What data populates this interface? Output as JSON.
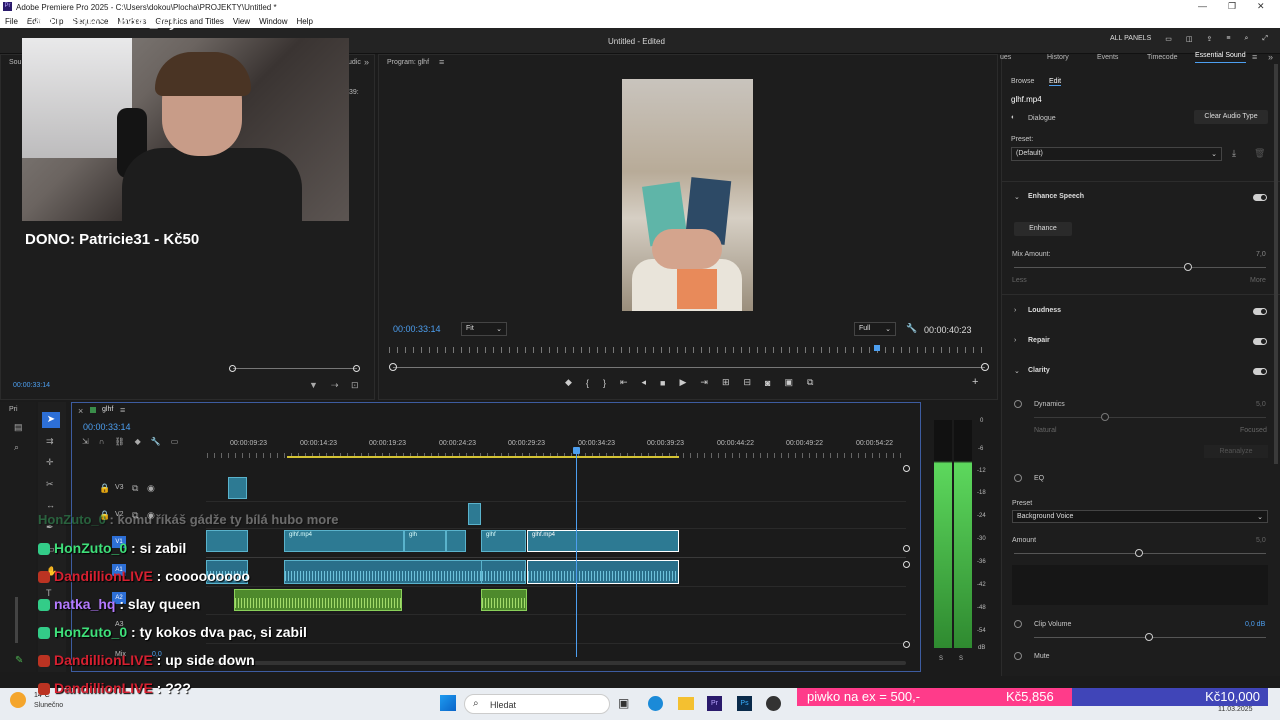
{
  "title_bar": {
    "app_title": "Adobe Premiere Pro 2025 - C:\\Users\\dokou\\Plocha\\PROJEKTY\\Untitled *"
  },
  "menu": [
    "File",
    "Edit",
    "Clip",
    "Sequence",
    "Markers",
    "Graphics and Titles",
    "View",
    "Window",
    "Help"
  ],
  "header": {
    "project_status": "Untitled - Edited",
    "all_panels": "ALL PANELS"
  },
  "overlay": {
    "last_sub": "LAST SUB: Ghost_Gy",
    "dono_line": "DONO: Patricie31 - Kč50"
  },
  "source": {
    "tab": "Sou",
    "tab2": "udic",
    "timecode": "00:00:33:14",
    "side_val": "39:"
  },
  "program": {
    "title": "Program: glhf",
    "timecode_left": "00:00:33:14",
    "fit": "Fit",
    "quality": "Full",
    "timecode_right": "00:00:40:23"
  },
  "essential": {
    "tabs": [
      "ues",
      "History",
      "Events",
      "Timecode",
      "Essential Sound"
    ],
    "subtabs": [
      "Browse",
      "Edit"
    ],
    "clip_name": "glhf.mp4",
    "type": "Dialogue",
    "clear_btn": "Clear Audio Type",
    "preset_label": "Preset:",
    "preset_value": "(Default)",
    "enhance_speech": "Enhance Speech",
    "enhance_btn": "Enhance",
    "mix_amount": "Mix Amount:",
    "mix_value": "7,0",
    "less": "Less",
    "more": "More",
    "loudness": "Loudness",
    "repair": "Repair",
    "clarity": "Clarity",
    "dynamics": "Dynamics",
    "dynamics_value": "5,0",
    "natural": "Natural",
    "focused": "Focused",
    "reanalyze": "Reanalyze",
    "eq": "EQ",
    "preset2_label": "Preset",
    "preset2_value": "Background Voice",
    "amount": "Amount",
    "amount_value": "5,0",
    "clip_volume": "Clip Volume",
    "clip_volume_value": "0,0 dB",
    "mute": "Mute"
  },
  "timeline": {
    "project_tab": "Pri",
    "seq_tab": "glhf",
    "timecode": "00:00:33:14",
    "ruler": [
      "00:00:09:23",
      "00:00:14:23",
      "00:00:19:23",
      "00:00:24:23",
      "00:00:29:23",
      "00:00:34:23",
      "00:00:39:23",
      "00:00:44:22",
      "00:00:49:22",
      "00:00:54:22"
    ],
    "tracks": [
      "V3",
      "V2",
      "V1",
      "A1",
      "A2",
      "A3",
      "Mix"
    ],
    "clip_labels": [
      "glhf.mp4",
      "glh",
      "glhf",
      "glhf.mp4"
    ],
    "mix_val": "0,0"
  },
  "meter": {
    "scale": [
      "0",
      "-6",
      "-12",
      "-18",
      "-24",
      "-30",
      "-36",
      "-42",
      "-48",
      "-54",
      "dB"
    ],
    "ss": [
      "S",
      "S"
    ]
  },
  "chat": [
    {
      "user": "HonZuto_0",
      "msg": "komu říkáš gádže ty bílá hubo more",
      "faded": true
    },
    {
      "user": "HonZuto_0",
      "msg": "si zabil"
    },
    {
      "user": "DandillionLIVE",
      "msg": "cooooooooo"
    },
    {
      "user": "natka_hq",
      "msg": "slay queen"
    },
    {
      "user": "HonZuto_0",
      "msg": "ty kokos dva pac, si zabil"
    },
    {
      "user": "DandillionLIVE",
      "msg": "up side down"
    },
    {
      "user": "DandillionLIVE",
      "msg": "???"
    }
  ],
  "donation_bar": {
    "goal_text": "piwko na ex = 500,-",
    "amount1": "Kč5,856",
    "amount2": "Kč10,000"
  },
  "taskbar": {
    "weather_temp": "14°C",
    "weather_desc": "Slunečno",
    "search": "Hledat",
    "date": "11.03.2025"
  }
}
